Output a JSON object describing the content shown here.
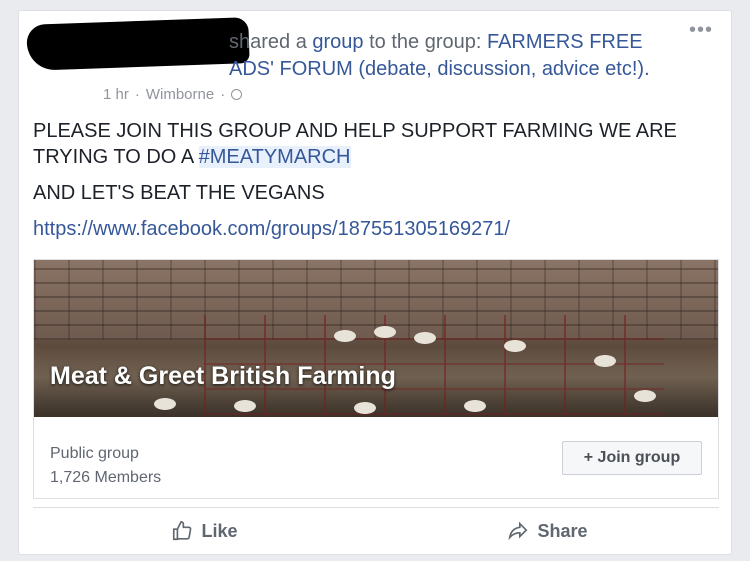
{
  "post": {
    "shared_text": "shared a group to the group:",
    "group_link_word": "group",
    "target_group": "FARMERS FREE ADS' FORUM (debate, discussion, advice etc!).",
    "time": "1 hr",
    "location": "Wimborne",
    "paragraph1_prefix": "PLEASE JOIN THIS GROUP AND HELP SUPPORT FARMING WE ARE TRYING TO DO A",
    "hashtag": "#MEATYMARCH",
    "paragraph2": "AND LET'S BEAT THE VEGANS",
    "url": "https://www.facebook.com/groups/187551305169271/"
  },
  "attachment": {
    "group_name": "Meat & Greet British Farming",
    "group_type": "Public group",
    "members": "1,726 Members",
    "join_label": "+ Join group"
  },
  "actions": {
    "like": "Like",
    "share": "Share"
  },
  "icons": {
    "more": "more-options-icon",
    "globe": "globe-icon",
    "like": "thumbs-up-icon",
    "share": "share-arrow-icon"
  },
  "colors": {
    "link": "#365899",
    "meta": "#90949c",
    "background": "#e9ebee"
  }
}
